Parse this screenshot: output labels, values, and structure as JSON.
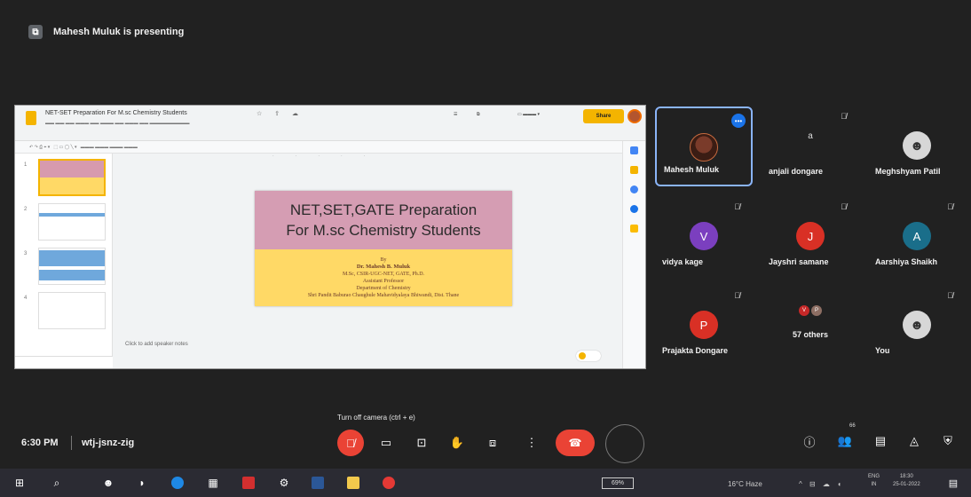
{
  "meeting": {
    "presenting_text": "Mahesh Muluk is presenting",
    "time": "6:30 PM",
    "code": "wtj-jsnz-zig",
    "tooltip": "Turn off camera (ctrl + e)",
    "participant_count_badge": "66"
  },
  "shared_doc": {
    "title": "NET-SET Preparation For M.sc Chemistry Students",
    "share_label": "Share",
    "notes_placeholder": "Click to add speaker notes",
    "slide": {
      "title_line1": "NET,SET,GATE  Preparation",
      "title_line2": "For M.sc Chemistry Students",
      "by": "By",
      "author": "Dr. Mahesh B. Muluk",
      "qualifications": "M.Sc, CSIR-UGC-NET, GATE, Ph.D.",
      "designation": "Assistant Professor",
      "department": "Department of Chemistry",
      "college": "Shri Pandit Baburao Chaughule Mahavidyalaya Bhiwandi, Dist. Thane"
    },
    "thumbnail_numbers": [
      "1",
      "2",
      "3",
      "4"
    ]
  },
  "participants": [
    {
      "name": "Mahesh Muluk",
      "initial": "",
      "avatar": "photo",
      "color": "",
      "active": true
    },
    {
      "name": "anjali dongare",
      "initial": "a",
      "avatar": "letter-small",
      "color": "",
      "active": false
    },
    {
      "name": "Meghshyam Patil",
      "initial": "",
      "avatar": "person",
      "color": "",
      "active": false
    },
    {
      "name": "vidya kage",
      "initial": "V",
      "avatar": "letter",
      "color": "#7b3fbf",
      "active": false
    },
    {
      "name": "Jayshri samane",
      "initial": "J",
      "avatar": "letter",
      "color": "#d93025",
      "active": false
    },
    {
      "name": "Aarshiya Shaikh",
      "initial": "A",
      "avatar": "letter",
      "color": "#1a6e8a",
      "active": false
    },
    {
      "name": "Prajakta Dongare",
      "initial": "P",
      "avatar": "letter",
      "color": "#d93025",
      "active": false
    },
    {
      "name": "57 others",
      "initial": "",
      "avatar": "group",
      "color": "",
      "active": false
    },
    {
      "name": "You",
      "initial": "",
      "avatar": "person",
      "color": "",
      "active": false
    }
  ],
  "taskbar": {
    "battery": "69%",
    "weather": "16°C Haze",
    "lang_line1": "ENG",
    "lang_line2": "IN",
    "time": "18:30",
    "date": "25-01-2022"
  },
  "icons": [
    "mic-off-icon",
    "camera-icon",
    "captions-icon",
    "raise-hand-icon",
    "present-icon",
    "more-vert-icon",
    "end-call-icon",
    "info-icon",
    "people-icon",
    "chat-icon",
    "activities-icon",
    "host-controls-icon"
  ],
  "colors": {
    "background": "#212121",
    "red": "#ea4335",
    "active_border": "#8ab4f8",
    "slide_pink": "#d59db3",
    "slide_yellow": "#ffd966"
  }
}
